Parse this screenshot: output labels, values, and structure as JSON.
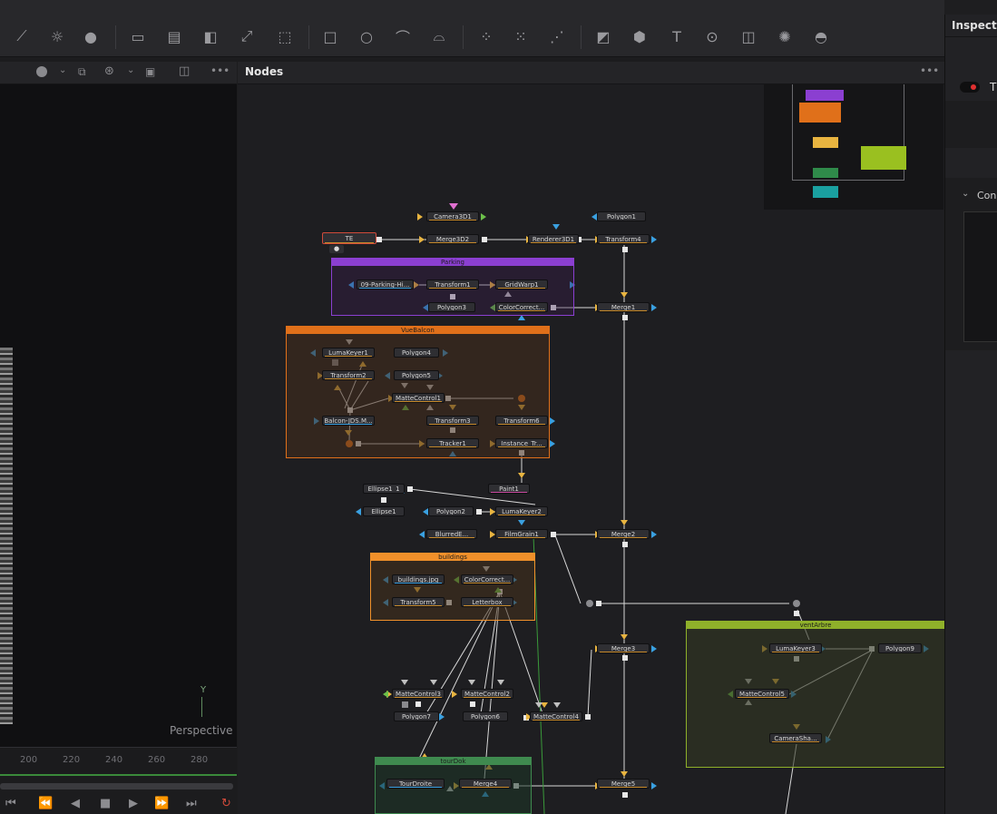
{
  "nodes_panel": {
    "title": "Nodes",
    "more": "•••"
  },
  "inspector": {
    "title": "Inspector",
    "section": "Con",
    "toggle_label": "T"
  },
  "viewer": {
    "label": "Perspective",
    "axis_y": "Y",
    "more": "•••"
  },
  "timeline": {
    "ticks": [
      "200",
      "220",
      "240",
      "260",
      "280"
    ]
  },
  "groups": {
    "parking": "Parking",
    "vuebalcon": "VueBalcon",
    "buildings": "buildings",
    "ventarbre": "ventArbre",
    "tourdok": "tourDok"
  },
  "nodes": {
    "camera3d1": "Camera3D1",
    "te": "TE",
    "merge3d2": "Merge3D2",
    "renderer3d1": "Renderer3D1",
    "polygon1": "Polygon1",
    "transform4": "Transform4",
    "parking_loader": "09-Parking-Hi...",
    "transform1": "Transform1",
    "gridwarp1": "GridWarp1",
    "polygon3": "Polygon3",
    "colorcorrect1": "ColorCorrect...",
    "merge1": "Merge1",
    "lumakeyer1": "LumaKeyer1",
    "polygon4": "Polygon4",
    "transform2": "Transform2",
    "polygon5": "Polygon5",
    "mattecontrol1": "MatteControl1",
    "balcon": "Balcon-JDS.M...",
    "transform3": "Transform3",
    "transform6": "Transform6",
    "tracker1": "Tracker1",
    "instance": "Instance_Tr...",
    "ellipse1_1": "Ellipse1_1",
    "paint1": "Paint1",
    "ellipse1": "Ellipse1",
    "polygon2": "Polygon2",
    "lumakeyer2": "LumaKeyer2",
    "blurred": "BlurredE...",
    "filmgrain1": "FilmGrain1",
    "merge2": "Merge2",
    "buildings_jpg": "buildings.jpg",
    "colorcorrect2": "ColorCorrect...",
    "transform5": "Transform5",
    "letterbox": "Letterbox",
    "merge3": "Merge3",
    "lumakeyer3": "LumaKeyer3",
    "polygon9": "Polygon9",
    "mattecontrol5": "MatteControl5",
    "camerashake": "CameraSha...",
    "mattecontrol3": "MatteControl3",
    "mattecontrol2": "MatteControl2",
    "polygon7": "Polygon7",
    "polygon6": "Polygon6",
    "mattecontrol4": "MatteControl4",
    "tourdroite": "TourDroite",
    "merge4": "Merge4",
    "merge5": "Merge5"
  },
  "colors": {
    "parking": "#8b3fd1",
    "vuebalcon": "#e0701a",
    "buildings": "#f0902a",
    "ventarbre": "#8fb02a",
    "tourdok": "#3f8a4f",
    "wire": "#d8d8d8",
    "mask_wire": "#3a9a3a"
  }
}
